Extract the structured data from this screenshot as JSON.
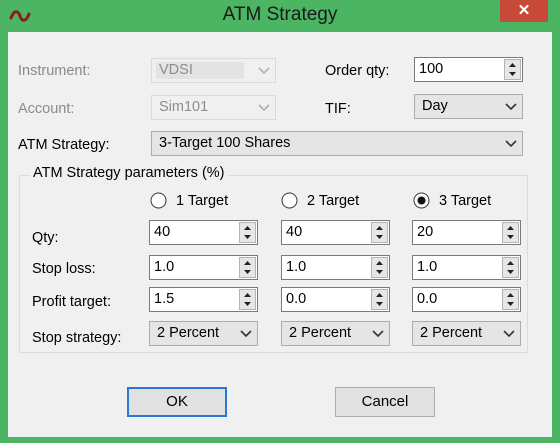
{
  "window": {
    "title": "ATM Strategy",
    "close_glyph": "✕"
  },
  "form": {
    "instrument": {
      "label": "Instrument:",
      "value": "VDSI"
    },
    "account": {
      "label": "Account:",
      "value": "Sim101"
    },
    "order_qty": {
      "label": "Order qty:",
      "value": "100"
    },
    "tif": {
      "label": "TIF:",
      "value": "Day"
    },
    "atm_strategy": {
      "label": "ATM Strategy:",
      "value": "3-Target 100 Shares"
    }
  },
  "params": {
    "group_label": "ATM Strategy parameters (%)",
    "targets": [
      {
        "label": "1 Target",
        "selected": false
      },
      {
        "label": "2 Target",
        "selected": false
      },
      {
        "label": "3 Target",
        "selected": true
      }
    ],
    "rows": {
      "qty": {
        "label": "Qty:",
        "values": [
          "40",
          "40",
          "20"
        ]
      },
      "stop_loss": {
        "label": "Stop loss:",
        "values": [
          "1.0",
          "1.0",
          "1.0"
        ]
      },
      "profit_target": {
        "label": "Profit target:",
        "values": [
          "1.5",
          "0.0",
          "0.0"
        ]
      },
      "stop_strategy": {
        "label": "Stop strategy:",
        "values": [
          "2 Percent",
          "2 Percent",
          "2 Percent"
        ]
      }
    }
  },
  "buttons": {
    "ok": "OK",
    "cancel": "Cancel"
  },
  "colors": {
    "titlebar": "#4cb564",
    "close": "#c74a39",
    "focus_border": "#2b78d2"
  }
}
